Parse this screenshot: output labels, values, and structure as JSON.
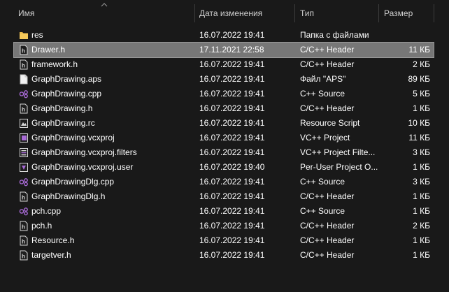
{
  "columns": {
    "name": "Имя",
    "date": "Дата изменения",
    "type": "Тип",
    "size": "Размер"
  },
  "files": [
    {
      "name": "res",
      "date": "16.07.2022 19:41",
      "type": "Папка с файлами",
      "size": "",
      "icon": "folder-icon",
      "selected": false
    },
    {
      "name": "Drawer.h",
      "date": "17.11.2021 22:58",
      "type": "C/C++ Header",
      "size": "11 КБ",
      "icon": "header-file-icon",
      "selected": true
    },
    {
      "name": "framework.h",
      "date": "16.07.2022 19:41",
      "type": "C/C++ Header",
      "size": "2 КБ",
      "icon": "header-file-icon",
      "selected": false
    },
    {
      "name": "GraphDrawing.aps",
      "date": "16.07.2022 19:41",
      "type": "Файл \"APS\"",
      "size": "89 КБ",
      "icon": "blank-file-icon",
      "selected": false
    },
    {
      "name": "GraphDrawing.cpp",
      "date": "16.07.2022 19:41",
      "type": "C++ Source",
      "size": "5 КБ",
      "icon": "cpp-source-icon",
      "selected": false
    },
    {
      "name": "GraphDrawing.h",
      "date": "16.07.2022 19:41",
      "type": "C/C++ Header",
      "size": "1 КБ",
      "icon": "header-file-icon",
      "selected": false
    },
    {
      "name": "GraphDrawing.rc",
      "date": "16.07.2022 19:41",
      "type": "Resource Script",
      "size": "10 КБ",
      "icon": "resource-script-icon",
      "selected": false
    },
    {
      "name": "GraphDrawing.vcxproj",
      "date": "16.07.2022 19:41",
      "type": "VC++ Project",
      "size": "11 КБ",
      "icon": "vcxproj-icon",
      "selected": false
    },
    {
      "name": "GraphDrawing.vcxproj.filters",
      "date": "16.07.2022 19:41",
      "type": "VC++ Project Filte...",
      "size": "3 КБ",
      "icon": "vcxproj-filters-icon",
      "selected": false
    },
    {
      "name": "GraphDrawing.vcxproj.user",
      "date": "16.07.2022 19:40",
      "type": "Per-User Project O...",
      "size": "1 КБ",
      "icon": "vcxproj-user-icon",
      "selected": false
    },
    {
      "name": "GraphDrawingDlg.cpp",
      "date": "16.07.2022 19:41",
      "type": "C++ Source",
      "size": "3 КБ",
      "icon": "cpp-source-icon",
      "selected": false
    },
    {
      "name": "GraphDrawingDlg.h",
      "date": "16.07.2022 19:41",
      "type": "C/C++ Header",
      "size": "1 КБ",
      "icon": "header-file-icon",
      "selected": false
    },
    {
      "name": "pch.cpp",
      "date": "16.07.2022 19:41",
      "type": "C++ Source",
      "size": "1 КБ",
      "icon": "cpp-source-icon",
      "selected": false
    },
    {
      "name": "pch.h",
      "date": "16.07.2022 19:41",
      "type": "C/C++ Header",
      "size": "2 КБ",
      "icon": "header-file-icon",
      "selected": false
    },
    {
      "name": "Resource.h",
      "date": "16.07.2022 19:41",
      "type": "C/C++ Header",
      "size": "1 КБ",
      "icon": "header-file-icon",
      "selected": false
    },
    {
      "name": "targetver.h",
      "date": "16.07.2022 19:41",
      "type": "C/C++ Header",
      "size": "1 КБ",
      "icon": "header-file-icon",
      "selected": false
    }
  ],
  "colors": {
    "background": "#191919",
    "selection": "#777777",
    "folder": "#e8b84a",
    "cpp_accent": "#a86ad6"
  }
}
